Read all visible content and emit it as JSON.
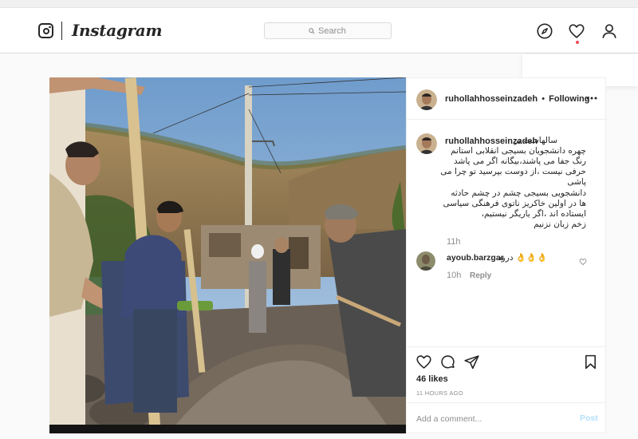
{
  "app": {
    "wordmark": "Instagram",
    "icons": [
      "instagram-glyph-icon",
      "search-icon",
      "explore-compass-icon",
      "activity-heart-icon",
      "profile-icon"
    ]
  },
  "search": {
    "placeholder": "Search"
  },
  "post": {
    "image_alt": "Men working with shovels on a rocky mountainside",
    "header": {
      "username": "ruhollahhosseinzadeh",
      "separator": "•",
      "follow_status": "Following"
    },
    "caption": {
      "username": "ruhollahhosseinzadeh",
      "lines": [
        "سالهاست بر",
        "چهره دانشجویان بسیجی انقلابی استانم",
        "رنگ جفا می پاشند،بیگانه اگر می پاشد",
        "حرفی نیست ،از دوست بپرسید تو چرا می",
        "پاشی",
        "دانشجویی بسیجی چشم در چشم حادثه",
        "ها در اولین خاکریز ناتوی فرهنگی سیاسی",
        "ایستاده اند ،اگر یاریگر نیستیم،",
        "زخم زبان نزنیم"
      ],
      "time": "11h"
    },
    "comments": [
      {
        "username": "ayoub.barzgar",
        "text": "درود 👌👌👌",
        "time": "10h",
        "reply_label": "Reply"
      }
    ],
    "likes": "46 likes",
    "posted": "11 HOURS AGO",
    "comment_placeholder": "Add a comment...",
    "post_label": "Post"
  },
  "colors": {
    "background": "#fafafa",
    "border": "#dbdbdb",
    "text": "#262626",
    "muted": "#8e8e8e",
    "post_button_disabled": "#b2dffc",
    "notification_dot": "#ed4956"
  }
}
